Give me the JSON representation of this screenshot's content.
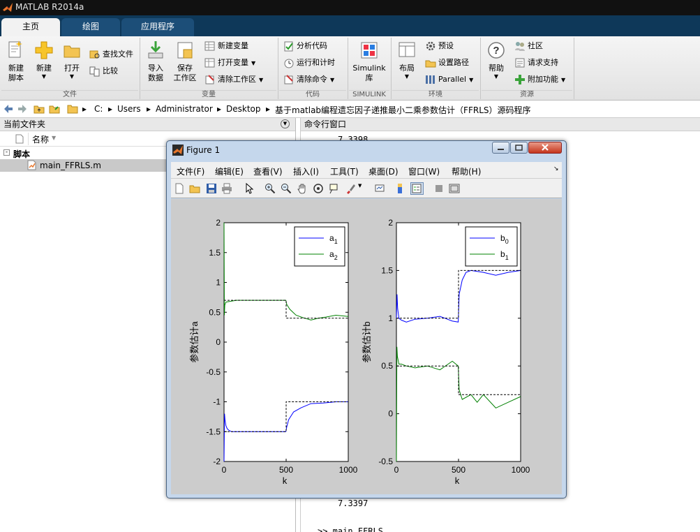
{
  "window": {
    "title": "MATLAB R2014a"
  },
  "tabs": [
    {
      "label": "主页"
    },
    {
      "label": "绘图"
    },
    {
      "label": "应用程序"
    }
  ],
  "ribbon": {
    "file": {
      "group": "文件",
      "new_script": "新建\n脚本",
      "new": "新建",
      "open": "打开",
      "find_files": "查找文件",
      "compare": "比较"
    },
    "variable": {
      "group": "变量",
      "import_data": "导入\n数据",
      "save_workspace": "保存\n工作区",
      "new_variable": "新建变量",
      "open_variable": "打开变量",
      "clear_workspace": "清除工作区"
    },
    "code": {
      "group": "代码",
      "analyze": "分析代码",
      "run_time": "运行和计时",
      "clear_commands": "清除命令"
    },
    "simulink": {
      "group": "SIMULINK",
      "button": "Simulink\n库"
    },
    "environment": {
      "group": "环境",
      "layout": "布局",
      "preferences": "预设",
      "set_path": "设置路径",
      "parallel": "Parallel"
    },
    "resources": {
      "group": "资源",
      "help": "帮助",
      "community": "社区",
      "request_support": "请求支持",
      "add_ons": "附加功能"
    }
  },
  "address": {
    "crumbs": [
      "C:",
      "Users",
      "Administrator",
      "Desktop",
      "基于matlab编程遗忘因子递推最小二乘参数估计（FFRLS）源码程序"
    ]
  },
  "current_folder": {
    "title": "当前文件夹",
    "column_name": "名称",
    "group": "脚本",
    "file": "main_FFRLS.m"
  },
  "command_window": {
    "title": "命令行窗口",
    "line_top": "7.3398",
    "line_bottom": "7.3397",
    "prompt_line": ">> main_FFRLS"
  },
  "figure": {
    "title": "Figure 1",
    "menu": [
      "文件(F)",
      "编辑(E)",
      "查看(V)",
      "插入(I)",
      "工具(T)",
      "桌面(D)",
      "窗口(W)",
      "帮助(H)"
    ]
  },
  "chart_data": [
    {
      "type": "line",
      "ylabel": "参数估计a",
      "xlabel": "k",
      "xlim": [
        0,
        1000
      ],
      "ylim": [
        -2,
        2
      ],
      "xticks": [
        "0",
        "500",
        "1000"
      ],
      "yticks": [
        "-2",
        "-1.5",
        "-1",
        "-0.5",
        "0",
        "0.5",
        "1",
        "1.5",
        "2"
      ],
      "legend_position": "top-right",
      "series": [
        {
          "name": "a",
          "subscript": "1",
          "color": "#0000ff",
          "x": [
            0,
            4,
            8,
            15,
            25,
            40,
            60,
            100,
            200,
            300,
            400,
            498,
            505,
            520,
            560,
            620,
            700,
            800,
            900,
            1000
          ],
          "y": [
            -2.0,
            -1.2,
            -1.3,
            -1.4,
            -1.45,
            -1.48,
            -1.5,
            -1.5,
            -1.5,
            -1.5,
            -1.5,
            -1.5,
            -1.42,
            -1.3,
            -1.17,
            -1.1,
            -1.03,
            -1.02,
            -1.0,
            -1.0
          ]
        },
        {
          "name": "a",
          "subscript": "2",
          "color": "#008000",
          "x": [
            0,
            3,
            6,
            15,
            40,
            100,
            200,
            300,
            400,
            498,
            505,
            530,
            580,
            650,
            700,
            760,
            820,
            900,
            1000
          ],
          "y": [
            2.0,
            0.45,
            0.62,
            0.67,
            0.68,
            0.7,
            0.7,
            0.7,
            0.7,
            0.7,
            0.63,
            0.55,
            0.45,
            0.4,
            0.37,
            0.4,
            0.42,
            0.45,
            0.43
          ]
        },
        {
          "name": "",
          "color": "#000000",
          "dashed": true,
          "x": [
            0,
            500,
            500,
            1000
          ],
          "y": [
            -1.5,
            -1.5,
            -1.0,
            -1.0
          ]
        },
        {
          "name": "",
          "color": "#000000",
          "dashed": true,
          "x": [
            0,
            500,
            500,
            1000
          ],
          "y": [
            0.7,
            0.7,
            0.4,
            0.4
          ]
        }
      ]
    },
    {
      "type": "line",
      "ylabel": "参数估计b",
      "xlabel": "k",
      "xlim": [
        0,
        1000
      ],
      "ylim": [
        -0.5,
        2
      ],
      "xticks": [
        "0",
        "500",
        "1000"
      ],
      "yticks": [
        "-0.5",
        "0",
        "0.5",
        "1",
        "1.5",
        "2"
      ],
      "legend_position": "top-right",
      "series": [
        {
          "name": "b",
          "subscript": "0",
          "color": "#0000ff",
          "x": [
            0,
            5,
            10,
            20,
            40,
            80,
            150,
            250,
            350,
            450,
            498,
            505,
            530,
            560,
            600,
            700,
            800,
            900,
            1000
          ],
          "y": [
            1.0,
            1.25,
            1.1,
            1.0,
            0.98,
            0.96,
            0.99,
            1.0,
            1.02,
            0.97,
            0.96,
            1.25,
            1.4,
            1.48,
            1.5,
            1.48,
            1.45,
            1.48,
            1.5
          ]
        },
        {
          "name": "b",
          "subscript": "1",
          "color": "#008000",
          "x": [
            0,
            4,
            8,
            20,
            40,
            80,
            150,
            250,
            350,
            450,
            498,
            505,
            530,
            600,
            650,
            700,
            800,
            900,
            1000
          ],
          "y": [
            -0.5,
            0.7,
            0.6,
            0.52,
            0.52,
            0.5,
            0.48,
            0.5,
            0.46,
            0.55,
            0.5,
            0.25,
            0.15,
            0.2,
            0.12,
            0.2,
            0.06,
            0.12,
            0.18
          ]
        },
        {
          "name": "",
          "color": "#000000",
          "dashed": true,
          "x": [
            0,
            500,
            500,
            1000
          ],
          "y": [
            1.0,
            1.0,
            1.5,
            1.5
          ]
        },
        {
          "name": "",
          "color": "#000000",
          "dashed": true,
          "x": [
            0,
            500,
            500,
            1000
          ],
          "y": [
            0.5,
            0.5,
            0.2,
            0.2
          ]
        }
      ]
    }
  ],
  "colors": {
    "accent": "#0e3859",
    "titlebar": "#111111",
    "figure_bg": "#cccccc"
  }
}
